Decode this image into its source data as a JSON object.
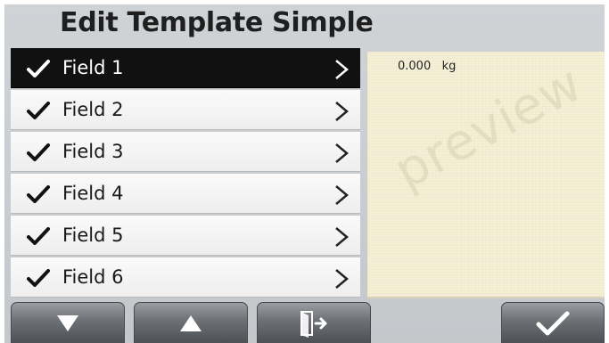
{
  "window": {
    "title": "Edit Template Simple"
  },
  "fields": [
    {
      "label": "Field 1",
      "checked": true,
      "selected": true
    },
    {
      "label": "Field 2",
      "checked": true,
      "selected": false
    },
    {
      "label": "Field 3",
      "checked": true,
      "selected": false
    },
    {
      "label": "Field 4",
      "checked": true,
      "selected": false
    },
    {
      "label": "Field 5",
      "checked": true,
      "selected": false
    },
    {
      "label": "Field 6",
      "checked": true,
      "selected": false
    }
  ],
  "preview": {
    "value": "0.000",
    "unit": "kg",
    "watermark": "preview"
  },
  "toolbar": {
    "buttons": [
      {
        "name": "scroll-down-button",
        "icon": "triangle-down-icon"
      },
      {
        "name": "scroll-up-button",
        "icon": "triangle-up-icon"
      },
      {
        "name": "exit-button",
        "icon": "exit-door-icon"
      },
      {
        "name": "confirm-button",
        "icon": "checkmark-icon"
      }
    ]
  },
  "colors": {
    "selected_row": "#111111",
    "preview_bg": "#f4efd6",
    "button": "#6c7075"
  }
}
